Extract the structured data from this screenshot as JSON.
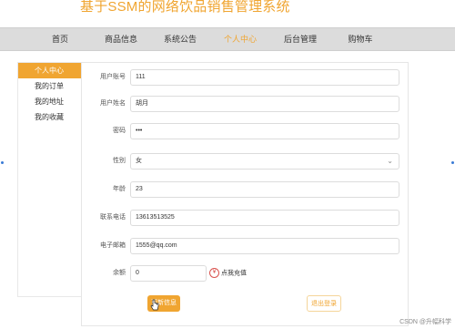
{
  "site": {
    "title": "基于SSM的网络饮品销售管理系统"
  },
  "nav": {
    "items": [
      {
        "label": "首页"
      },
      {
        "label": "商品信息"
      },
      {
        "label": "系统公告"
      },
      {
        "label": "个人中心"
      },
      {
        "label": "后台管理"
      },
      {
        "label": "购物车"
      }
    ],
    "active_index": 3
  },
  "sidebar": {
    "items": [
      {
        "label": "个人中心"
      },
      {
        "label": "我的订单"
      },
      {
        "label": "我的地址"
      },
      {
        "label": "我的收藏"
      }
    ],
    "active_index": 0
  },
  "form": {
    "account": {
      "label": "用户账号",
      "value": "111"
    },
    "name": {
      "label": "用户姓名",
      "value": "胡月"
    },
    "password": {
      "label": "密码",
      "value": "•••"
    },
    "gender": {
      "label": "性别",
      "value": "女"
    },
    "age": {
      "label": "年龄",
      "value": "23"
    },
    "phone": {
      "label": "联系电话",
      "value": "13613513525"
    },
    "email": {
      "label": "电子邮箱",
      "value": "1555@qq.com"
    },
    "balance": {
      "label": "余额",
      "value": "0",
      "sign_label": "点我充值",
      "sign_icon": "yen-icon"
    }
  },
  "buttons": {
    "update": "更新信息",
    "logout": "退出登录"
  },
  "watermark": "CSDN @升幅科学",
  "colors": {
    "accent": "#f0a531",
    "nav_bg": "#dcdcdc"
  }
}
